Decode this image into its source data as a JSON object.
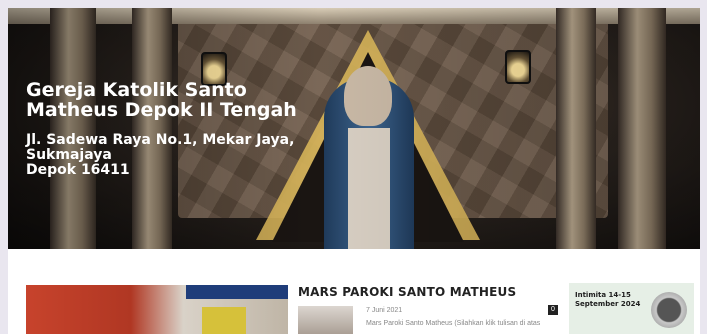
{
  "hero": {
    "church_name": "Gereja Katolik Santo Matheus Depok II Tengah",
    "address": "Jl. Sadewa Raya No.1, Mekar Jaya, Sukmajaya\nDepok 16411"
  },
  "post": {
    "title": "MARS PAROKI SANTO MATHEUS",
    "date": "7 Juni 2021",
    "excerpt": "Mars Paroki Santo Matheus (Silahkan klik tulisan di atas",
    "comment_count": "0"
  },
  "sidebar_card": {
    "title": "Intimita 14-15 September 2024"
  }
}
